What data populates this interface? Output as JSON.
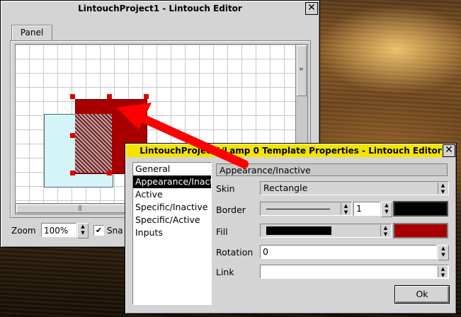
{
  "editor": {
    "title": "LintouchProject1 - Lintouch Editor",
    "tab": "Panel",
    "zoom_label": "Zoom",
    "zoom_value": "100%",
    "snap_label": "Sna"
  },
  "props": {
    "title": "LintouchProject1/Lamp 0 Template Properties - Lintouch Editor",
    "list_items": [
      "General",
      "Appearance/Inactive",
      "Active",
      "Specific/Inactive",
      "Specific/Active",
      "Inputs"
    ],
    "section_title": "Appearance/Inactive",
    "skin_label": "Skin",
    "skin_value": "Rectangle",
    "border_label": "Border",
    "border_width": "1",
    "fill_label": "Fill",
    "rotation_label": "Rotation",
    "rotation_value": "0",
    "link_label": "Link",
    "link_value": "",
    "ok_label": "Ok"
  },
  "colors": {
    "lamp_fill": "#a80000",
    "lamp_selected": "#c80000",
    "label_box": "#d4f4f8",
    "dialog_title": "#f4e400",
    "arrow": "#ff0000",
    "border_color": "#000000",
    "fill_color": "#a80000"
  }
}
